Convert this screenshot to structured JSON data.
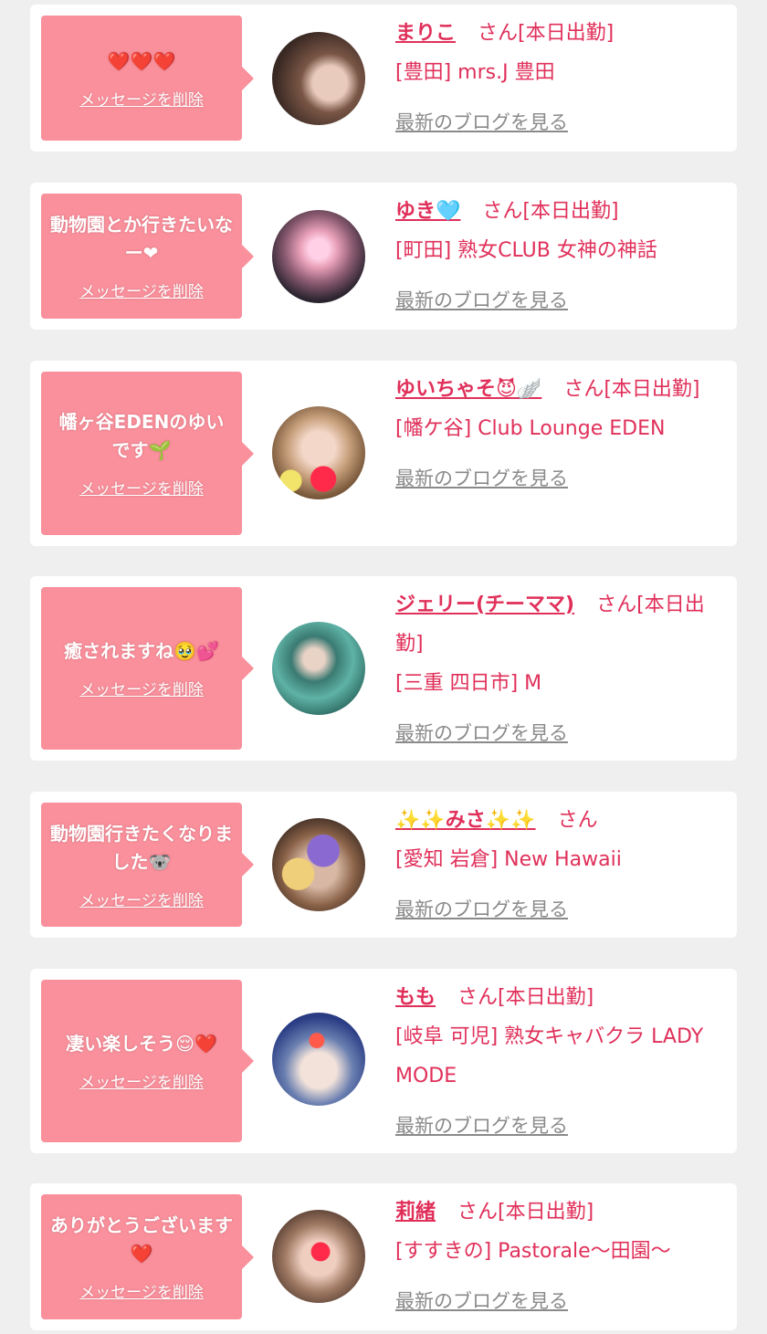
{
  "colors": {
    "background": "#efefef",
    "card": "#ffffff",
    "bubble": "#f9909c",
    "accent": "#e0305a",
    "muted": "#8a8a8a"
  },
  "messages": [
    {
      "message": "❤️❤️❤️",
      "delete_label": "メッセージを削除",
      "name": "まりこ",
      "suffix": "さん[本日出勤]",
      "shop": "[豊田] mrs.J 豊田",
      "blog_label": "最新のブログを見る"
    },
    {
      "message": "動物園とか行きたいなー❤",
      "delete_label": "メッセージを削除",
      "name": "ゆき🩵",
      "suffix": "さん[本日出勤]",
      "shop": "[町田] 熟女CLUB 女神の神話",
      "blog_label": "最新のブログを見る"
    },
    {
      "message": "幡ヶ谷EDENのゆいです🌱",
      "delete_label": "メッセージを削除",
      "name": "ゆいちゃそ😈🪽",
      "suffix": "さん[本日出勤]",
      "shop": "[幡ケ谷] Club Lounge EDEN",
      "blog_label": "最新のブログを見る"
    },
    {
      "message": "癒されますね🥹💕",
      "delete_label": "メッセージを削除",
      "name": "ジェリー(チーママ)",
      "suffix": "さん[本日出勤]",
      "shop": "[三重 四日市] M",
      "blog_label": "最新のブログを見る"
    },
    {
      "message": "動物園行きたくなりました🐨",
      "delete_label": "メッセージを削除",
      "name": "✨✨みさ✨✨",
      "suffix": "さん",
      "shop": "[愛知 岩倉] New Hawaii",
      "blog_label": "最新のブログを見る"
    },
    {
      "message": "凄い楽しそう😌❤️",
      "delete_label": "メッセージを削除",
      "name": "もも",
      "suffix": "さん[本日出勤]",
      "shop": "[岐阜 可児] 熟女キャバクラ LADY MODE",
      "blog_label": "最新のブログを見る"
    },
    {
      "message": "ありがとうございます❤️",
      "delete_label": "メッセージを削除",
      "name": "莉緒",
      "suffix": "さん[本日出勤]",
      "shop": "[すすきの] Pastorale〜田園〜",
      "blog_label": "最新のブログを見る"
    }
  ]
}
